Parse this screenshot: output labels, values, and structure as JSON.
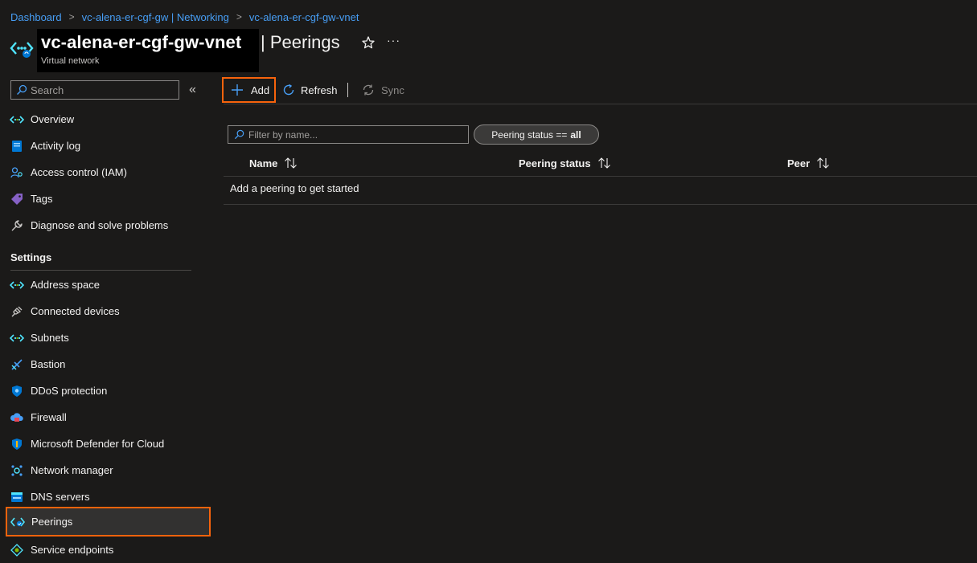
{
  "breadcrumb": {
    "items": [
      "Dashboard",
      "vc-alena-er-cgf-gw | Networking",
      "vc-alena-er-cgf-gw-vnet"
    ],
    "separator": ">"
  },
  "header": {
    "resource_name": "vc-alena-er-cgf-gw-vnet",
    "page_title": "| Peerings",
    "resource_type": "Virtual network",
    "more_label": "···"
  },
  "sidebar": {
    "search_placeholder": "Search",
    "collapse_label": "«",
    "items": [
      {
        "label": "Overview",
        "icon": "vnet-icon"
      },
      {
        "label": "Activity log",
        "icon": "activity-log-icon"
      },
      {
        "label": "Access control (IAM)",
        "icon": "iam-icon"
      },
      {
        "label": "Tags",
        "icon": "tag-icon"
      },
      {
        "label": "Diagnose and solve problems",
        "icon": "wrench-icon"
      }
    ],
    "settings_title": "Settings",
    "settings_items": [
      {
        "label": "Address space",
        "icon": "vnet-icon"
      },
      {
        "label": "Connected devices",
        "icon": "plug-icon"
      },
      {
        "label": "Subnets",
        "icon": "vnet-icon"
      },
      {
        "label": "Bastion",
        "icon": "bastion-icon"
      },
      {
        "label": "DDoS protection",
        "icon": "shield-icon"
      },
      {
        "label": "Firewall",
        "icon": "firewall-icon"
      },
      {
        "label": "Microsoft Defender for Cloud",
        "icon": "defender-shield-icon"
      },
      {
        "label": "Network manager",
        "icon": "network-manager-icon"
      },
      {
        "label": "DNS servers",
        "icon": "dns-icon"
      },
      {
        "label": "Peerings",
        "icon": "peering-icon",
        "active": true
      },
      {
        "label": "Service endpoints",
        "icon": "service-endpoint-icon"
      }
    ]
  },
  "toolbar": {
    "add_label": "Add",
    "refresh_label": "Refresh",
    "sync_label": "Sync"
  },
  "filters": {
    "filter_placeholder": "Filter by name...",
    "pill_label": "Peering status ==",
    "pill_value": "all"
  },
  "table": {
    "columns": [
      "Name",
      "Peering status",
      "Peer"
    ],
    "empty_message": "Add a peering to get started"
  },
  "colors": {
    "accent": "#479ef5",
    "highlight": "#f7630c",
    "background": "#1b1a19"
  }
}
